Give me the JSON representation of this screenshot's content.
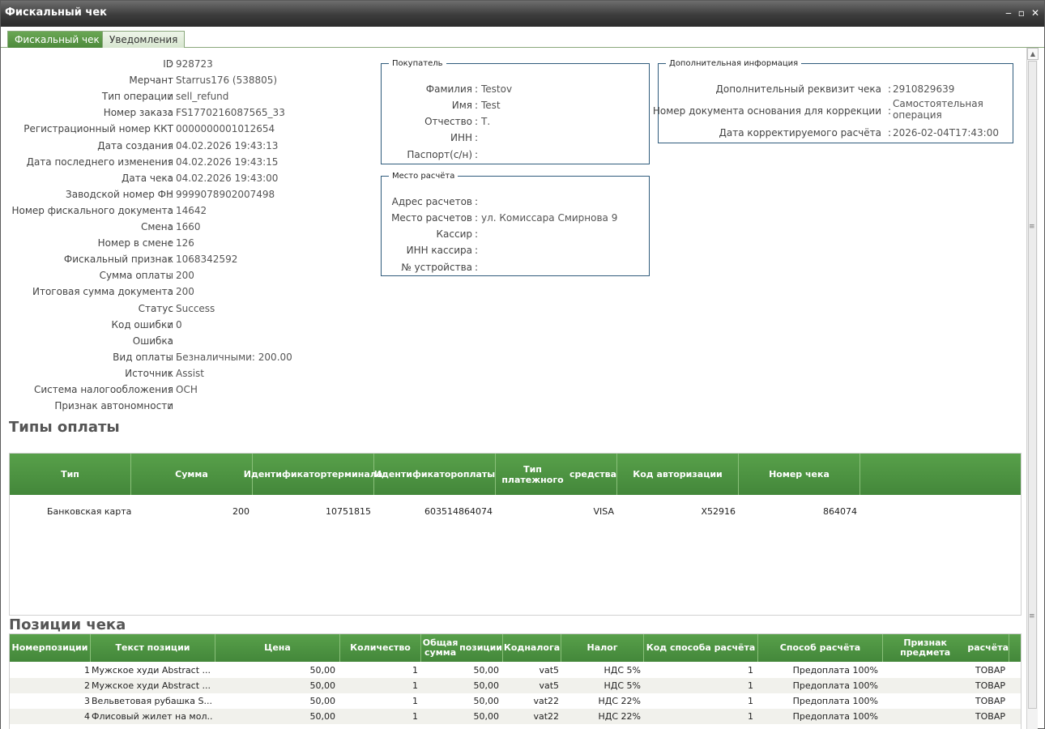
{
  "window": {
    "title": "Фискальный чек",
    "controls": [
      "‒",
      "▫",
      "✕"
    ]
  },
  "tabs": [
    {
      "label": "Фискальный чек",
      "active": true
    },
    {
      "label": "Уведомления",
      "active": false
    }
  ],
  "fields": [
    {
      "label": "ID",
      "value": "928723"
    },
    {
      "label": "Мерчант",
      "value": "Starrus176 (538805)"
    },
    {
      "label": "Тип операции",
      "value": "sell_refund"
    },
    {
      "label": "Номер заказа",
      "value": "FS1770216087565_33"
    },
    {
      "label": "Регистрационный номер ККТ",
      "value": "0000000001012654"
    },
    {
      "label": "Дата создания",
      "value": "04.02.2026 19:43:13"
    },
    {
      "label": "Дата последнего изменения",
      "value": "04.02.2026 19:43:15"
    },
    {
      "label": "Дата чека",
      "value": "04.02.2026 19:43:00"
    },
    {
      "label": "Заводской номер ФН",
      "value": "9999078902007498"
    },
    {
      "label": "Номер фискального документа",
      "value": "14642"
    },
    {
      "label": "Смена",
      "value": "1660"
    },
    {
      "label": "Номер в смене",
      "value": "126"
    },
    {
      "label": "Фискальный признак",
      "value": "1068342592"
    },
    {
      "label": "Сумма оплаты",
      "value": "200"
    },
    {
      "label": "Итоговая сумма документа",
      "value": "200"
    },
    {
      "label": "Статус",
      "value": "Success"
    },
    {
      "label": "Код ошибки",
      "value": "0"
    },
    {
      "label": "Ошибка",
      "value": ""
    },
    {
      "label": "Вид оплаты",
      "value": "Безналичными: 200.00"
    },
    {
      "label": "Источник",
      "value": "Assist"
    },
    {
      "label": "Система налогообложения",
      "value": "ОСН"
    },
    {
      "label": "Признак автономности",
      "value": ""
    }
  ],
  "buyer": {
    "legend": "Покупатель",
    "rows": [
      {
        "label": "Фамилия",
        "value": "Testov"
      },
      {
        "label": "Имя",
        "value": "Test"
      },
      {
        "label": "Отчество",
        "value": "Т."
      },
      {
        "label": "ИНН",
        "value": ""
      },
      {
        "label": "Паспорт(с/н)",
        "value": ""
      }
    ]
  },
  "place": {
    "legend": "Место расчёта",
    "rows": [
      {
        "label": "Адрес расчетов",
        "value": ""
      },
      {
        "label": "Место расчетов",
        "value": "ул. Комиссара Смирнова 9"
      },
      {
        "label": "Кассир",
        "value": ""
      },
      {
        "label": "ИНН кассира",
        "value": ""
      },
      {
        "label": "№ устройства",
        "value": ""
      }
    ]
  },
  "extra": {
    "legend": "Дополнительная информация",
    "rows": [
      {
        "label": "Дополнительный реквизит чека",
        "value": "2910829639"
      },
      {
        "label": "Номер документа основания для коррекции",
        "value": "Самостоятельная",
        "value2": "операция"
      },
      {
        "label": "Дата корректируемого расчёта",
        "value": "2026-02-04T17:43:00"
      }
    ]
  },
  "separator": ":",
  "payments": {
    "title": "Типы оплаты",
    "headers": [
      "Тип",
      "Сумма",
      "Идентификатор\nтерминала",
      "Идентификатор\nоплаты",
      "Тип платежного\nсредства",
      "Код авторизации",
      "Номер чека"
    ],
    "rows": [
      [
        "Банковская карта",
        "200",
        "10751815",
        "603514864074",
        "VISA",
        "X52916",
        "864074"
      ]
    ]
  },
  "items": {
    "title": "Позиции чека",
    "headers": [
      "Номер\nпозиции",
      "Текст позиции",
      "Цена",
      "Количество",
      "Общая сумма\nпозиции",
      "Код\nналога",
      "Налог",
      "Код способа расчёта",
      "Способ расчёта",
      "Признак предмета\nрасчёта"
    ],
    "rows": [
      [
        "1",
        "Мужское худи Abstract ...",
        "50,00",
        "1",
        "50,00",
        "vat5",
        "НДС 5%",
        "1",
        "Предоплата 100%",
        "ТОВАР"
      ],
      [
        "2",
        "Мужское худи Abstract ...",
        "50,00",
        "1",
        "50,00",
        "vat5",
        "НДС 5%",
        "1",
        "Предоплата 100%",
        "ТОВАР"
      ],
      [
        "3",
        "Вельветовая рубашка S...",
        "50,00",
        "1",
        "50,00",
        "vat22",
        "НДС 22%",
        "1",
        "Предоплата 100%",
        "ТОВАР"
      ],
      [
        "4",
        "Флисовый жилет на мол...",
        "50,00",
        "1",
        "50,00",
        "vat22",
        "НДС 22%",
        "1",
        "Предоплата 100%",
        "ТОВАР"
      ]
    ]
  }
}
